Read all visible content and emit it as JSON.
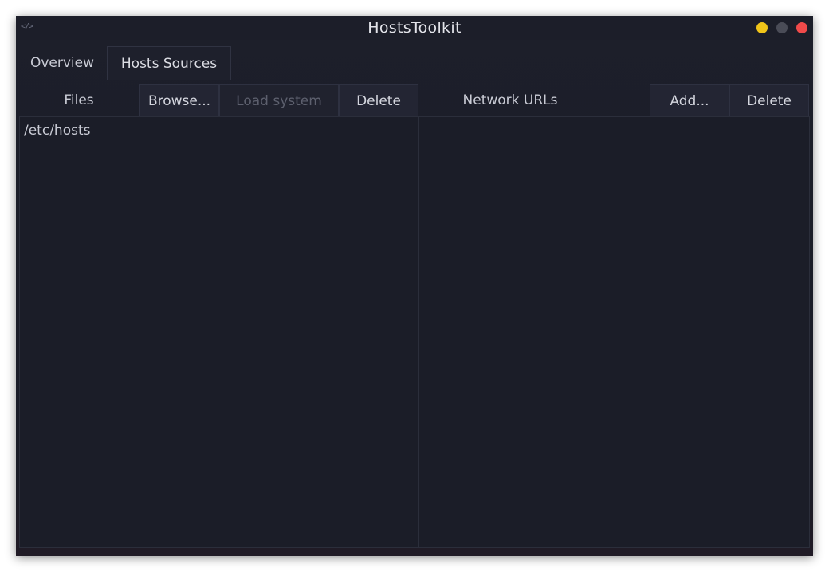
{
  "window": {
    "title": "HostsToolkit",
    "app_icon": "</>",
    "controls": {
      "minimize_color": "#f0c419",
      "maximize_color": "#4a4c57",
      "close_color": "#f04a4a"
    }
  },
  "tabs": [
    {
      "label": "Overview",
      "active": false
    },
    {
      "label": "Hosts Sources",
      "active": true
    }
  ],
  "files_panel": {
    "label": "Files",
    "browse_label": "Browse...",
    "load_system_label": "Load system",
    "load_system_enabled": false,
    "delete_label": "Delete",
    "items": [
      "/etc/hosts"
    ]
  },
  "urls_panel": {
    "label": "Network URLs",
    "add_label": "Add...",
    "delete_label": "Delete",
    "items": []
  }
}
